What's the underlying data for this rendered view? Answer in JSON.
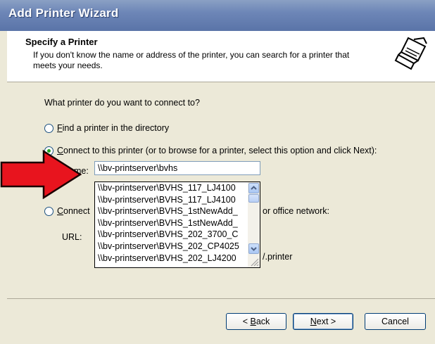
{
  "window": {
    "title": "Add Printer Wizard"
  },
  "header": {
    "title": "Specify a Printer",
    "subtitle": "If you don't know the name or address of the printer, you can search for a printer that meets your needs.",
    "icon": "printer-icon"
  },
  "question": "What printer do you want to connect to?",
  "options": {
    "find": {
      "label_prefix": "",
      "accel": "F",
      "label_rest": "ind a printer in the directory",
      "checked": false
    },
    "connect": {
      "accel": "C",
      "label_rest": "onnect to this printer (or to browse for a printer, select this option and click Next):",
      "checked": true
    },
    "internet": {
      "accel": "C",
      "label_rest": "onnect",
      "tail": "or office network:",
      "checked": false
    }
  },
  "name_field": {
    "label": "Name:",
    "value": "\\\\bv-printserver\\bvhs"
  },
  "url_field": {
    "label": "URL:",
    "tail": "/.printer"
  },
  "autocomplete": [
    "\\\\bv-printserver\\BVHS_117_LJ4100",
    "\\\\bv-printserver\\BVHS_117_LJ4100",
    "\\\\bv-printserver\\BVHS_1stNewAdd_",
    "\\\\bv-printserver\\BVHS_1stNewAdd_",
    "\\\\bv-printserver\\BVHS_202_3700_C",
    "\\\\bv-printserver\\BVHS_202_CP4025",
    "\\\\bv-printserver\\BVHS_202_LJ4200"
  ],
  "buttons": {
    "back": {
      "accel": "B",
      "rest": "ack",
      "prefix": "< "
    },
    "next": {
      "accel": "N",
      "rest": "ext >"
    },
    "cancel": "Cancel"
  },
  "colors": {
    "title_bar": "#6d86b7",
    "annotation_arrow": "#e8141e",
    "dialog_bg": "#ece9d8"
  }
}
